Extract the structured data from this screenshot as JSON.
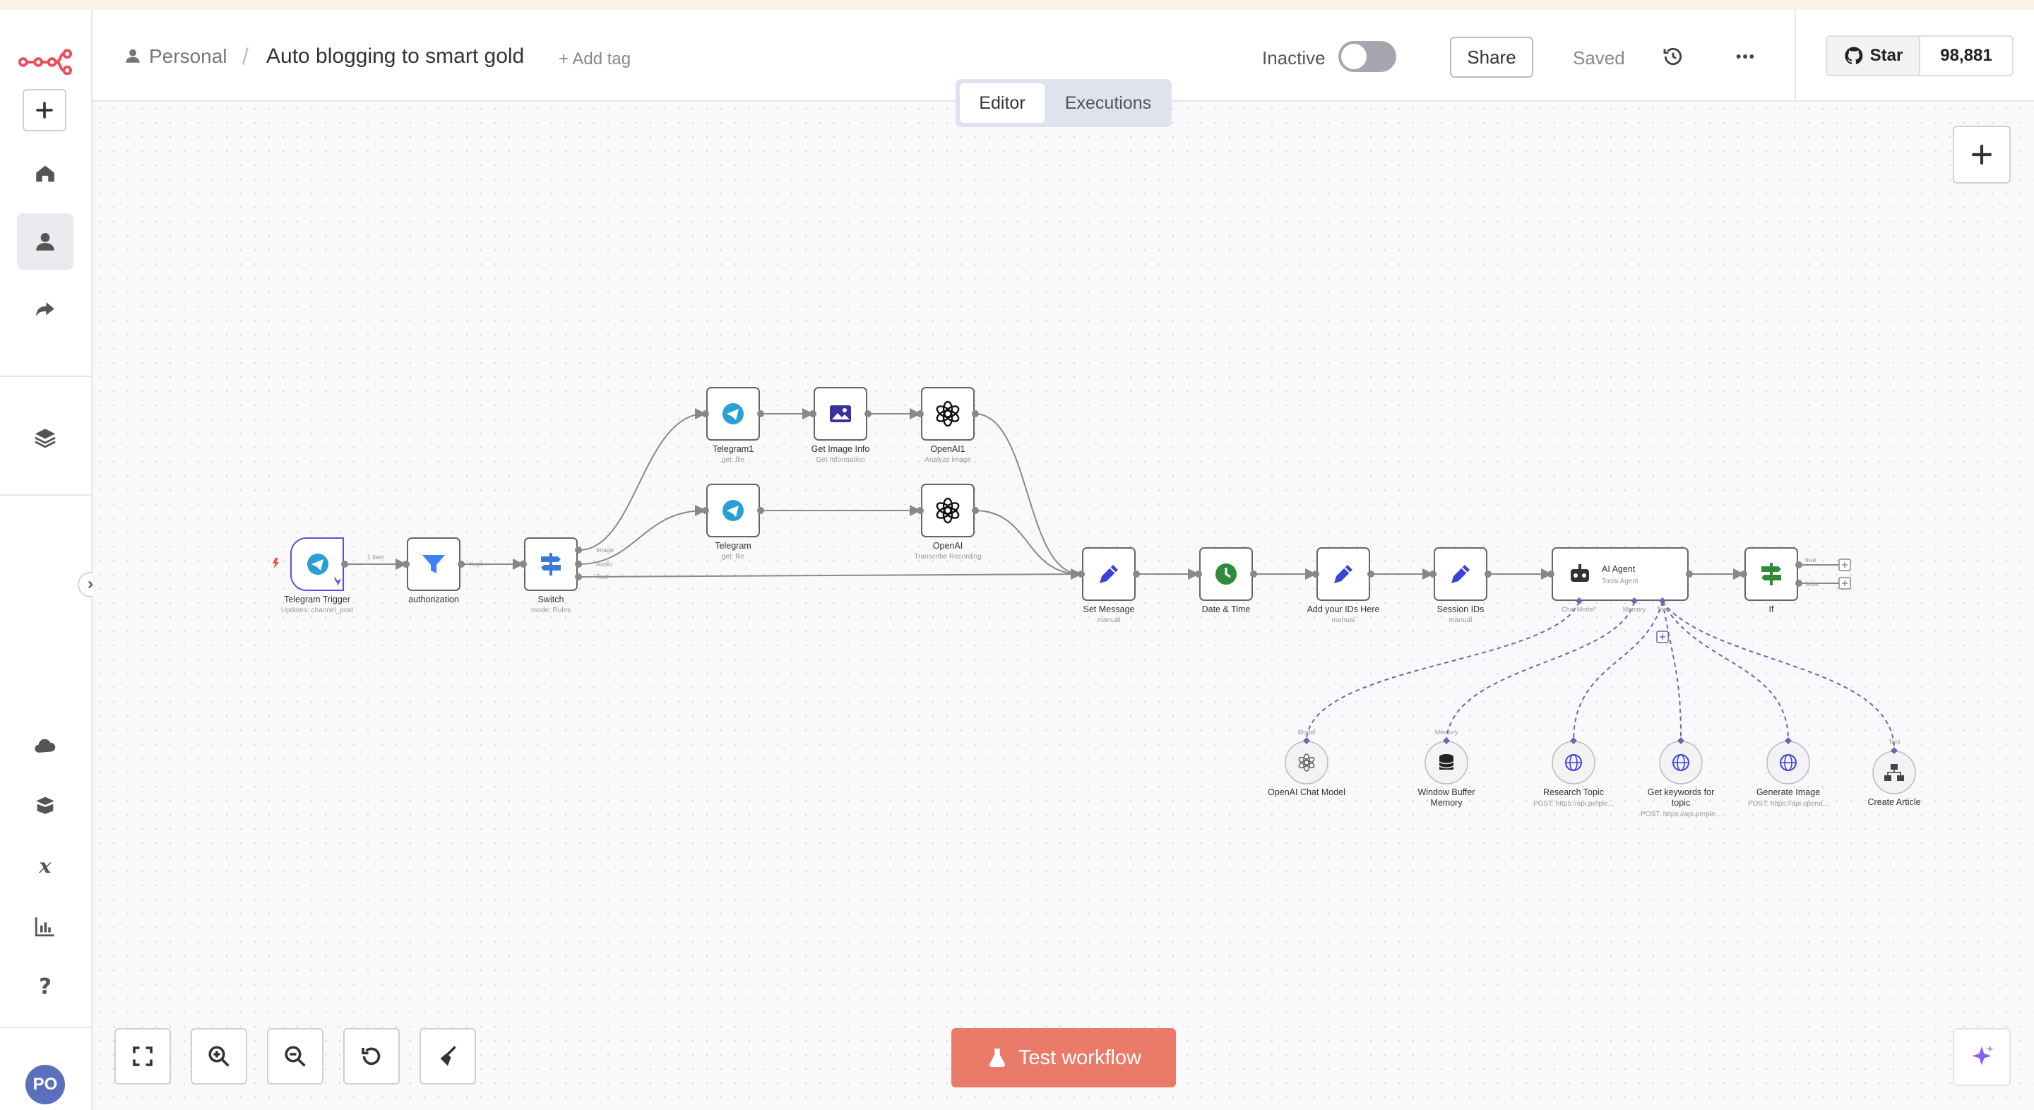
{
  "header": {
    "project": "Personal",
    "separator": "/",
    "workflow_name": "Auto blogging to smart gold",
    "add_tag": "+ Add tag",
    "status": "Inactive",
    "share": "Share",
    "saved": "Saved",
    "github_star": "Star",
    "github_count": "98,881"
  },
  "tabs": {
    "editor": "Editor",
    "executions": "Executions"
  },
  "test_button": "Test workflow",
  "avatar_initials": "PO",
  "colors": {
    "accent": "#ea7b68",
    "brand": "#e8505b",
    "tab_bg": "#dfe3ee",
    "node_purple": "#5f4fd8"
  },
  "sidebar_icons": [
    "n8n-logo-icon",
    "plus-icon",
    "home-icon",
    "user-icon",
    "share-icon",
    "layers-icon",
    "cloud-icon",
    "templates-icon",
    "variables-icon",
    "insights-icon",
    "help-icon"
  ],
  "nodes": {
    "telegram_trigger": {
      "label": "Telegram Trigger",
      "sub": "Updates: channel_post"
    },
    "authorization": {
      "label": "authorization",
      "sub": ""
    },
    "switch": {
      "label": "Switch",
      "sub": "mode: Rules"
    },
    "telegram1": {
      "label": "Telegram1",
      "sub": "get: file"
    },
    "get_image_info": {
      "label": "Get Image Info",
      "sub": "Get Information"
    },
    "openai1": {
      "label": "OpenAI1",
      "sub": "Analyze image"
    },
    "telegram": {
      "label": "Telegram",
      "sub": "get: file"
    },
    "openai": {
      "label": "OpenAI",
      "sub": "Transcribe Recording"
    },
    "set_message": {
      "label": "Set Message",
      "sub": "manual"
    },
    "date_time": {
      "label": "Date & Time",
      "sub": ""
    },
    "add_ids": {
      "label": "Add your IDs Here",
      "sub": "manual"
    },
    "session_ids": {
      "label": "Session IDs",
      "sub": "manual"
    },
    "ai_agent": {
      "label": "AI Agent",
      "sub": "Tools Agent"
    },
    "if_node": {
      "label": "If",
      "sub": ""
    },
    "openai_chat_model": {
      "label": "OpenAI Chat Model",
      "sub": ""
    },
    "window_buffer_memory": {
      "label": "Window Buffer",
      "label2": "Memory",
      "sub": ""
    },
    "research_topic": {
      "label": "Research Topic",
      "sub": "POST: https://api.perple..."
    },
    "get_keywords": {
      "label": "Get keywords for",
      "label2": "topic",
      "sub": "POST: https://api.perple..."
    },
    "generate_image": {
      "label": "Generate Image",
      "sub": "POST: https://api.opena..."
    },
    "create_article": {
      "label": "Create Article",
      "sub": ""
    }
  },
  "edge_labels": {
    "items": "1 item",
    "kept": "Kept",
    "image": "Image",
    "audio": "Audio",
    "text": "Text",
    "chat_model": "Chat Model*",
    "memory": "Memory",
    "tool": "Tool",
    "true": "true",
    "false": "false",
    "model": "Model"
  }
}
